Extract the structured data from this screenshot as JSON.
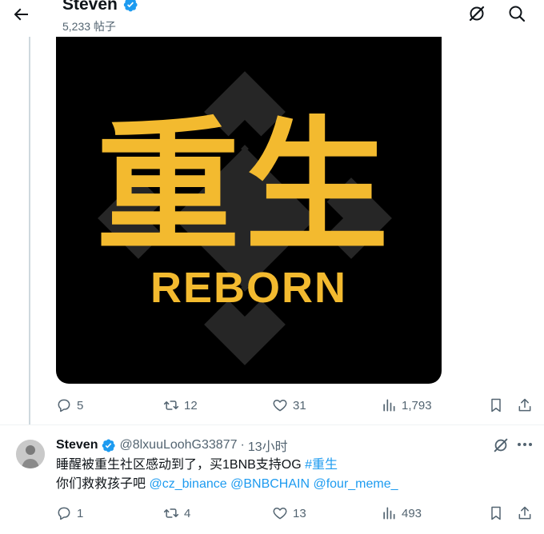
{
  "header": {
    "title": "Steven",
    "post_count": "5,233 帖子"
  },
  "media": {
    "title_cn": "重生",
    "subtitle_en": "REBORN",
    "colors": {
      "gold": "#f3ba2f",
      "background": "#000000",
      "logo_gray": "#262626"
    }
  },
  "post1_actions": {
    "replies": "5",
    "reposts": "12",
    "likes": "31",
    "views": "1,793"
  },
  "reply_tweet": {
    "name": "Steven",
    "handle": "@8lxuuLoohG33877",
    "separator": "·",
    "time": "13小时",
    "text_line1": "睡醒被重生社区感动到了，买1BNB支持OG ",
    "hashtag": "#重生",
    "text_line2_prefix": "你们救救孩子吧 ",
    "mention1": "@cz_binance",
    "mention2": "@BNBCHAIN",
    "mention3": "@four_meme_"
  },
  "post2_actions": {
    "replies": "1",
    "reposts": "4",
    "likes": "13",
    "views": "493"
  },
  "icons": {
    "back": "arrow-left-icon",
    "grok": "grok-icon",
    "search": "search-icon",
    "verified": "verified-badge-icon",
    "reply": "reply-icon",
    "repost": "repost-icon",
    "like": "heart-icon",
    "views": "views-icon",
    "bookmark": "bookmark-icon",
    "share": "share-icon",
    "more": "more-icon"
  },
  "accent_color": "#1d9bf0"
}
